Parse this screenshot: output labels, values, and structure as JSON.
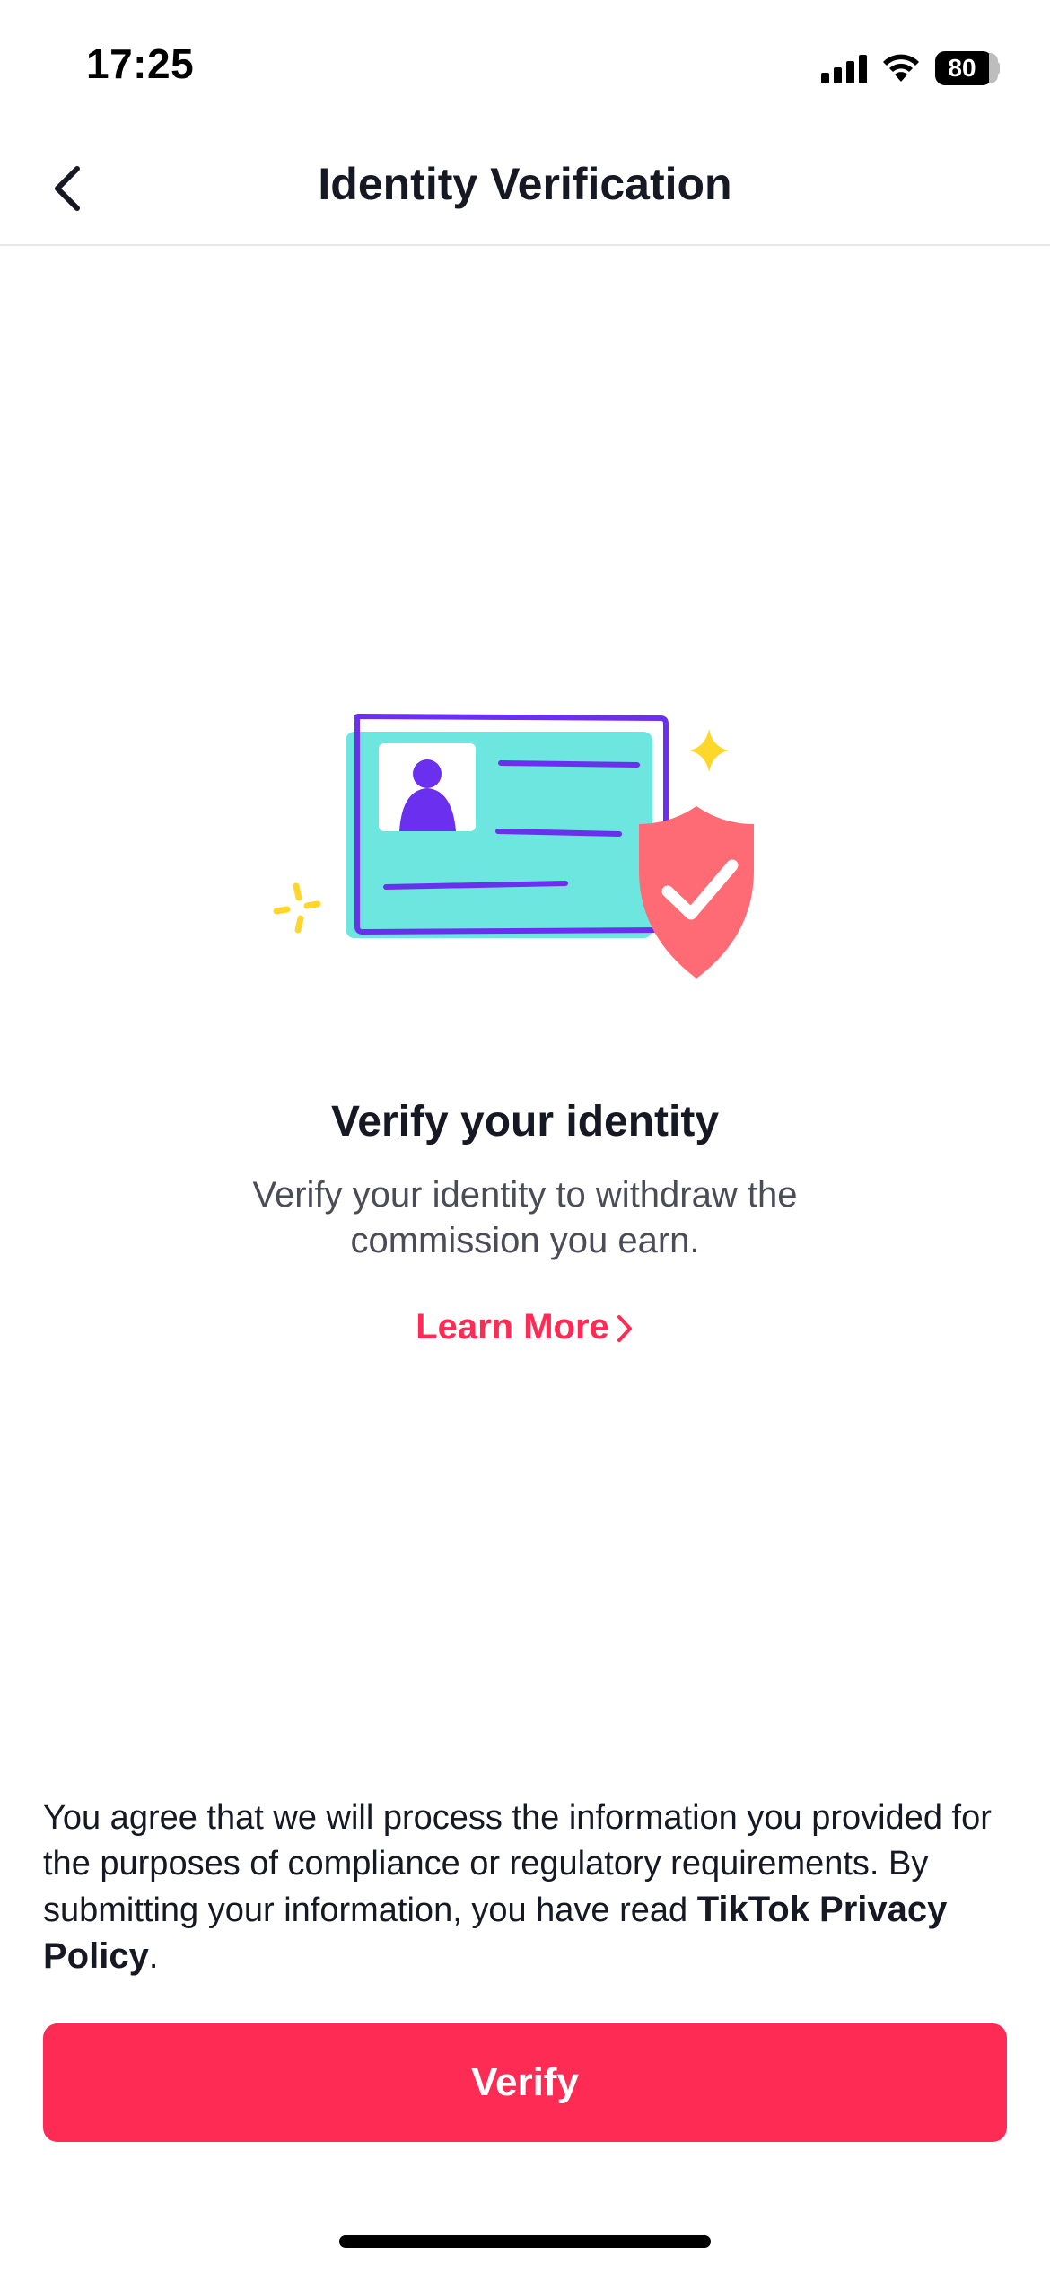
{
  "status_bar": {
    "time": "17:25",
    "battery": "80"
  },
  "nav": {
    "title": "Identity Verification",
    "back_icon": "chevron-left-icon"
  },
  "illustration": {
    "icon": "id-card-shield-check-icon",
    "colors": {
      "card": "#6ee6e0",
      "outline": "#6b2ff0",
      "shield": "#ff6b74",
      "sparkle": "#ffd72b"
    }
  },
  "content": {
    "headline": "Verify your identity",
    "description": "Verify your identity to withdraw the commission you earn.",
    "learn_more": "Learn More"
  },
  "legal": {
    "text": "You agree that we will process the information you provided for the purposes of compliance or regulatory requirements. By submitting your information, you have read ",
    "link": "TikTok Privacy Policy",
    "end": "."
  },
  "actions": {
    "verify_label": "Verify"
  },
  "colors": {
    "accent": "#fe2c55",
    "text": "#161823",
    "secondary_text": "#4b4c55"
  }
}
